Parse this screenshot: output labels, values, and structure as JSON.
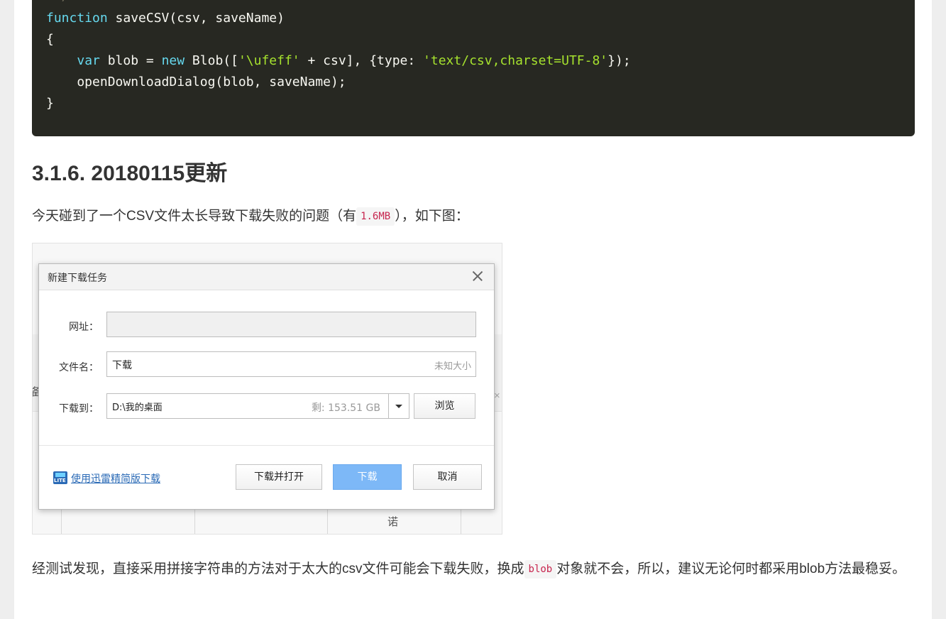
{
  "code": {
    "comment_end": " */",
    "lines": [
      {
        "kw": "function",
        "rest": " saveCSV(csv, saveName)"
      },
      {
        "plain": "{"
      },
      {
        "indent": "    ",
        "kw": "var",
        "mid1": " blob = ",
        "kw2": "new",
        "mid2": " Blob([",
        "str1": "'\\ufeff'",
        "mid3": " + csv], {type: ",
        "str2": "'text/csv,charset=UTF-8'",
        "end": "});"
      },
      {
        "plain": "    openDownloadDialog(blob, saveName);"
      },
      {
        "plain": "}"
      }
    ]
  },
  "heading": "3.1.6. 20180115更新",
  "para1": {
    "before": "今天碰到了一个CSV文件太长导致下载失败的问题（有",
    "code": "1.6MB",
    "after": "），如下图："
  },
  "figure": {
    "background_chars": {
      "left": "备",
      "right": "×",
      "bottom": "诺"
    },
    "dialog": {
      "title": "新建下载任务",
      "url_label": "网址：",
      "url_value": "",
      "filename_label": "文件名：",
      "filename_value": "下载",
      "filename_hint": "未知大小",
      "saveto_label": "下载到：",
      "saveto_value": "D:\\我的桌面",
      "saveto_space": "剩: 153.51 GB",
      "browse_button": "浏览",
      "lite_link": "使用迅雷精简版下载",
      "download_open_button": "下载并打开",
      "download_button": "下载",
      "cancel_button": "取消"
    }
  },
  "para2": {
    "before": "经测试发现，直接采用拼接字符串的方法对于太大的csv文件可能会下载失败，换成",
    "code": "blob",
    "after": "对象就不会，所以，建议无论何时都采用blob方法最稳妥。"
  }
}
